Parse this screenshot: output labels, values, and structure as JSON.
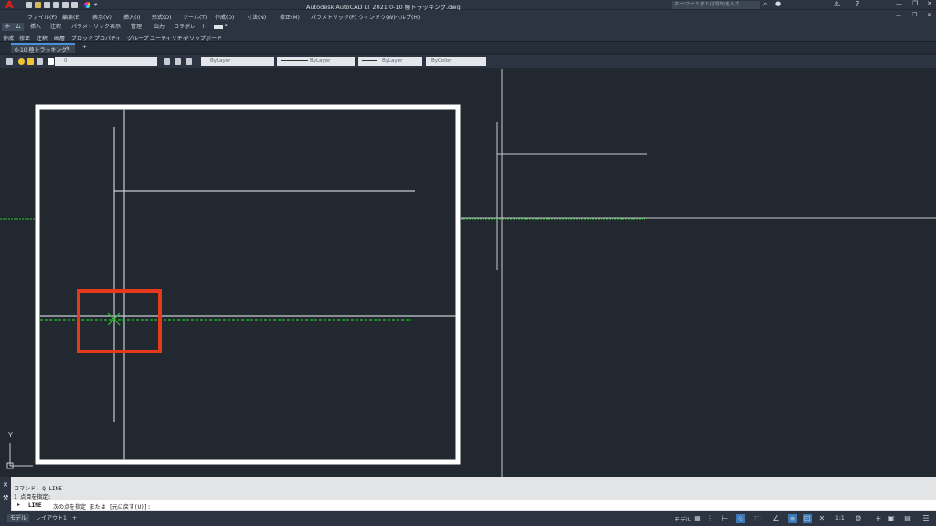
{
  "app": {
    "title": "Autodesk AutoCAD LT 2021   0-10 極トラッキング.dwg",
    "logo": "A"
  },
  "search": {
    "placeholder": "キーワードまたは語句を入力"
  },
  "menu": [
    "ファイル(F)",
    "編集(E)",
    "表示(V)",
    "挿入(I)",
    "形式(O)",
    "ツール(T)",
    "作成(D)",
    "寸法(N)",
    "修正(M)",
    "パラメトリック(P)",
    "ウィンドウ(W)",
    "ヘルプ(H)"
  ],
  "ribbon_tabs": [
    "ホーム",
    "挿入",
    "注釈",
    "パラメトリック",
    "表示",
    "管理",
    "出力",
    "コラボレート"
  ],
  "panels": [
    "作成",
    "修正",
    "注釈",
    "画層",
    "ブロック",
    "プロパティ",
    "グループ",
    "ユーティリティ",
    "クリップボード"
  ],
  "doc_tab": {
    "label": "0-10 極トラッキング*",
    "close": "×",
    "add": "+"
  },
  "properties": {
    "layer": "0",
    "color": "ByLayer",
    "linetype": "ByLayer",
    "lineweight": "ByLayer",
    "plotstyle": "ByColor"
  },
  "ucs": {
    "y_label": "Y"
  },
  "command": {
    "history1": "コマンド: Q LINE",
    "history2": "1 点目を指定:",
    "prompt_cmd": "LINE",
    "prompt_text": "次の点を指定 または [元に戻す(U)]:"
  },
  "status": {
    "model_tab": "モデル",
    "layout_tab": "レイアウト1",
    "add": "+",
    "model_btn": "モデル",
    "scale": "1:1"
  },
  "colors": {
    "highlight": "#e8381c",
    "tracking": "#2bbf2b",
    "frame": "#ffffff"
  }
}
